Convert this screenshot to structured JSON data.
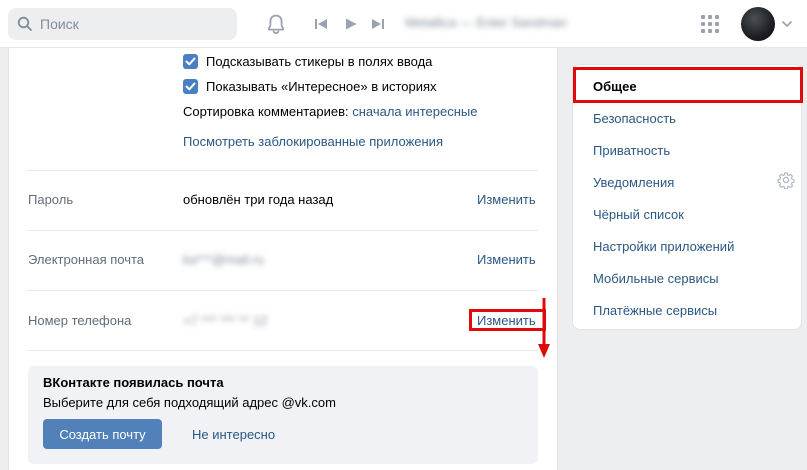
{
  "header": {
    "search_placeholder": "Поиск",
    "track_title": "Metallica — Enter Sandman"
  },
  "settings": {
    "checkbox_stickers": "Подсказывать стикеры в полях ввода",
    "checkbox_interesting": "Показывать «Интересное» в историях",
    "sort_label": "Сортировка комментариев:",
    "sort_value": "сначала интересные",
    "blocked_apps_link": "Посмотреть заблокированные приложения",
    "rows": [
      {
        "label": "Пароль",
        "value": "обновлён три года назад",
        "action": "Изменить"
      },
      {
        "label": "Электронная почта",
        "value": "ka***@mail.ru",
        "action": "Изменить"
      },
      {
        "label": "Номер телефона",
        "value": "+7 *** *** ** 12",
        "action": "Изменить"
      }
    ]
  },
  "promo": {
    "title": "ВКонтакте появилась почта",
    "subtitle": "Выберите для себя подходящий адрес @vk.com",
    "create_button": "Создать почту",
    "dismiss": "Не интересно"
  },
  "side_menu": {
    "items": [
      {
        "label": "Общее",
        "active": true
      },
      {
        "label": "Безопасность"
      },
      {
        "label": "Приватность"
      },
      {
        "label": "Уведомления"
      },
      {
        "label": "Чёрный список"
      },
      {
        "label": "Настройки приложений"
      },
      {
        "label": "Мобильные сервисы"
      },
      {
        "label": "Платёжные сервисы"
      }
    ]
  },
  "colors": {
    "link": "#2a5885",
    "accent": "#5181b8",
    "highlight": "#e00a0a"
  }
}
